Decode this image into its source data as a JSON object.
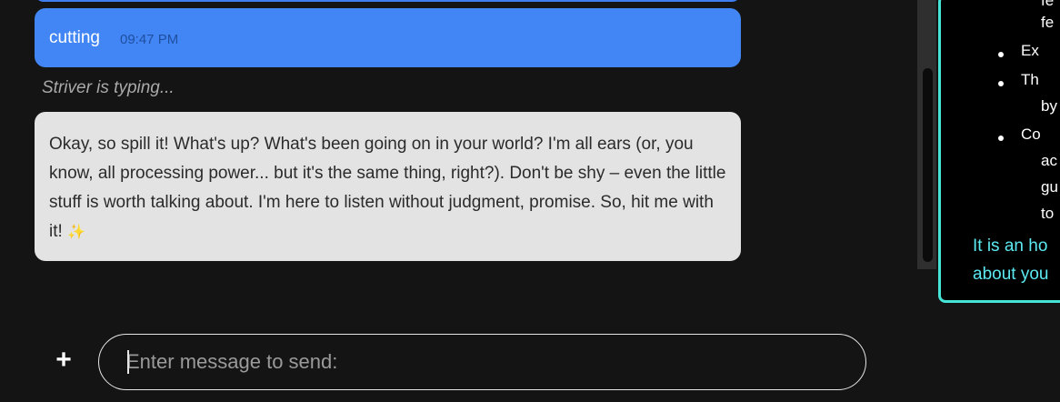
{
  "chat": {
    "user_message": {
      "text": "cutting",
      "time": "09:47 PM"
    },
    "typing_indicator": "Striver is typing...",
    "bot_message": {
      "text": "Okay, so spill it! What's up? What's been going on in your world? I'm all ears (or, you know, all processing power... but it's the same thing, right?). Don't be shy – even the little stuff is worth talking about. I'm here to listen without judgment, promise. So, hit me with it!",
      "emoji": "✨"
    }
  },
  "composer": {
    "plus_label": "+",
    "placeholder": "Enter message to send:"
  },
  "side_panel": {
    "fragments": [
      "fe",
      "Ex",
      "Th",
      "by",
      "Co",
      "ac",
      "gu",
      "to"
    ],
    "cyan_lines": [
      "It is an ho",
      "about you"
    ],
    "border_color": "#46e4d6",
    "text_color": "#5ce9f2"
  },
  "colors": {
    "user_bubble": "#4286f5",
    "bot_bubble": "#e3e3e3",
    "background": "#141414"
  }
}
